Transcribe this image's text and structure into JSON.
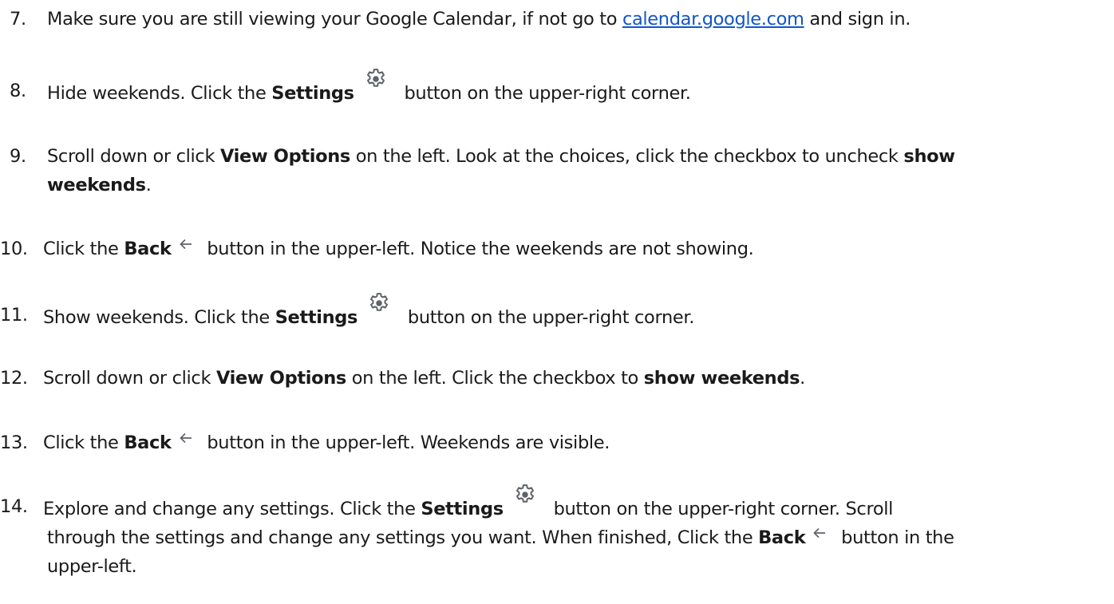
{
  "steps": [
    {
      "number": "7.",
      "parts": {
        "t1": "Make sure you are still viewing your Google Calendar, if not go to ",
        "link": "calendar.google.com",
        "t2": " and sign in."
      }
    },
    {
      "number": "8.",
      "parts": {
        "t1": "Hide weekends. Click the ",
        "b1": "Settings",
        "t2": " button on the upper-right corner."
      }
    },
    {
      "number": "9.",
      "parts": {
        "t1": "Scroll down or click ",
        "b1": "View Options",
        "t2": " on the left. Look at the choices, click the checkbox to uncheck ",
        "b2": "show",
        "b3": "weekends",
        "t3": "."
      }
    },
    {
      "number": "10.",
      "parts": {
        "t1": "Click the ",
        "b1": "Back",
        "t2": " button in the upper-left. Notice the weekends are not showing."
      }
    },
    {
      "number": "11.",
      "parts": {
        "t1": "Show weekends. Click the ",
        "b1": "Settings",
        "t2": " button on the upper-right corner."
      }
    },
    {
      "number": "12.",
      "parts": {
        "t1": "Scroll down or click ",
        "b1": "View Options",
        "t2": " on the left. Click the checkbox to ",
        "b2": "show weekends",
        "t3": "."
      }
    },
    {
      "number": "13.",
      "parts": {
        "t1": "Click the ",
        "b1": "Back",
        "t2": " button in the upper-left. Weekends are visible."
      }
    },
    {
      "number": "14.",
      "parts": {
        "t1": "Explore and change any settings. Click the ",
        "b1": "Settings",
        "t2": " button on the upper-right corner. Scroll",
        "t3": "through the settings and change any settings you want. When finished, Click the ",
        "b2": "Back",
        "t4": " button in the",
        "t5": "upper-left."
      }
    }
  ],
  "icons": {
    "settings": "gear-icon",
    "back": "back-arrow-icon"
  },
  "colors": {
    "text": "#1a1a1a",
    "link": "#1155cc",
    "icon": "#5f6368"
  }
}
